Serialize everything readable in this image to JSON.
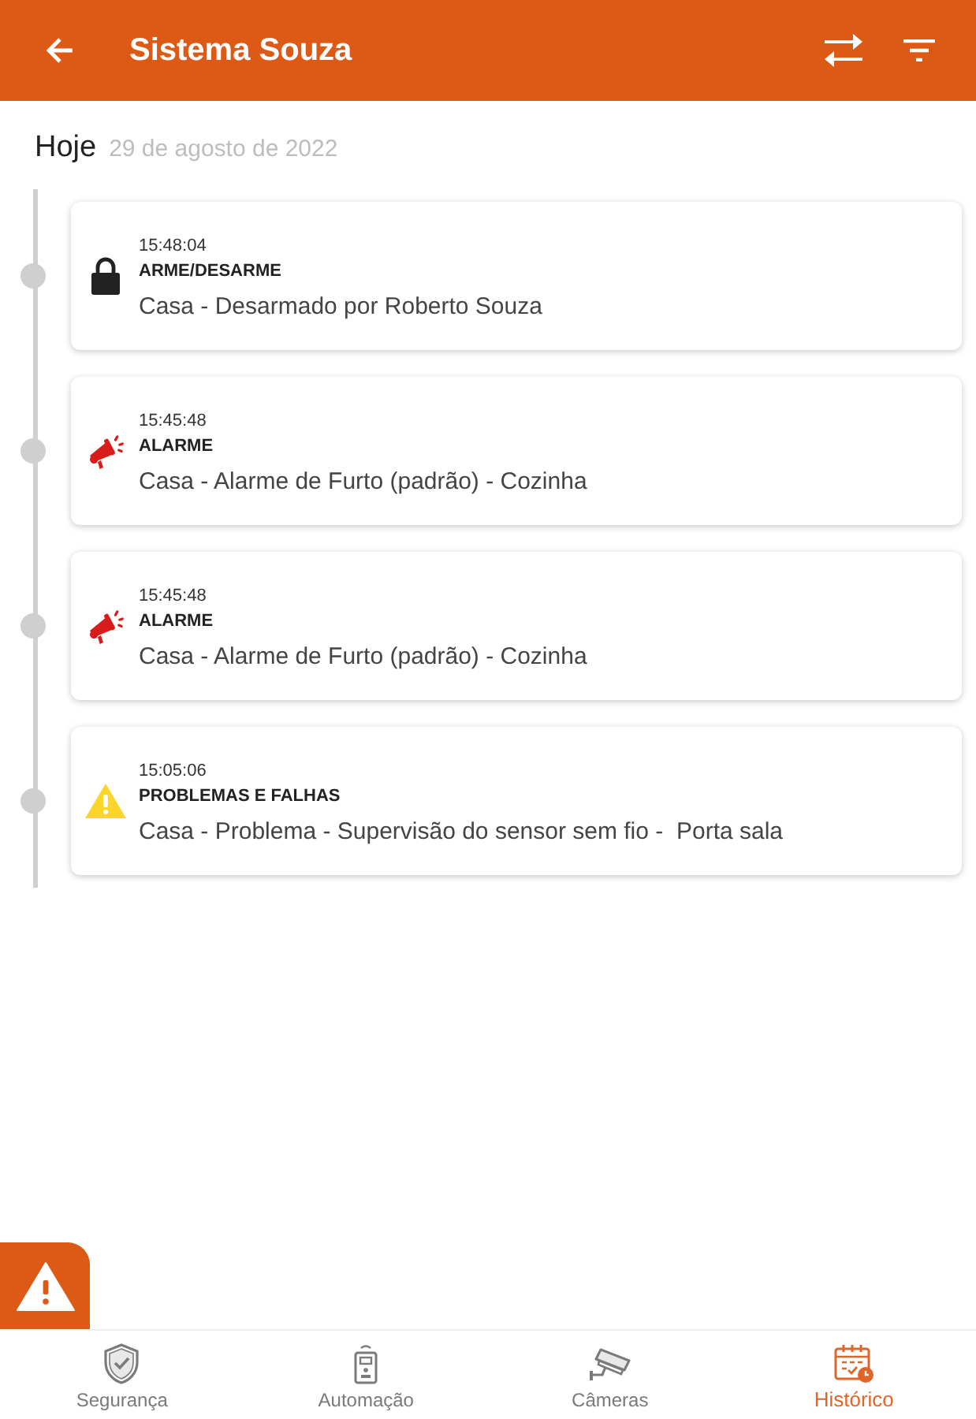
{
  "header": {
    "title": "Sistema Souza"
  },
  "date_heading": {
    "label": "Hoje",
    "date": "29 de agosto de 2022"
  },
  "events": [
    {
      "kind": "lock",
      "time": "15:48:04",
      "category": "ARME/DESARME",
      "description": "Casa - Desarmado por Roberto Souza"
    },
    {
      "kind": "alarm",
      "time": "15:45:48",
      "category": "ALARME",
      "description": "Casa - Alarme de Furto (padrão) - Cozinha"
    },
    {
      "kind": "alarm",
      "time": "15:45:48",
      "category": "ALARME",
      "description": "Casa - Alarme de Furto (padrão) - Cozinha"
    },
    {
      "kind": "warning",
      "time": "15:05:06",
      "category": "PROBLEMAS E FALHAS",
      "description": "Casa - Problema - Supervisão do sensor sem fio -  Porta sala"
    }
  ],
  "nav": [
    {
      "kind": "shield",
      "label": "Segurança",
      "selected": false
    },
    {
      "kind": "remote",
      "label": "Automação",
      "selected": false
    },
    {
      "kind": "camera",
      "label": "Câmeras",
      "selected": false
    },
    {
      "kind": "calendar",
      "label": "Histórico",
      "selected": true
    }
  ]
}
